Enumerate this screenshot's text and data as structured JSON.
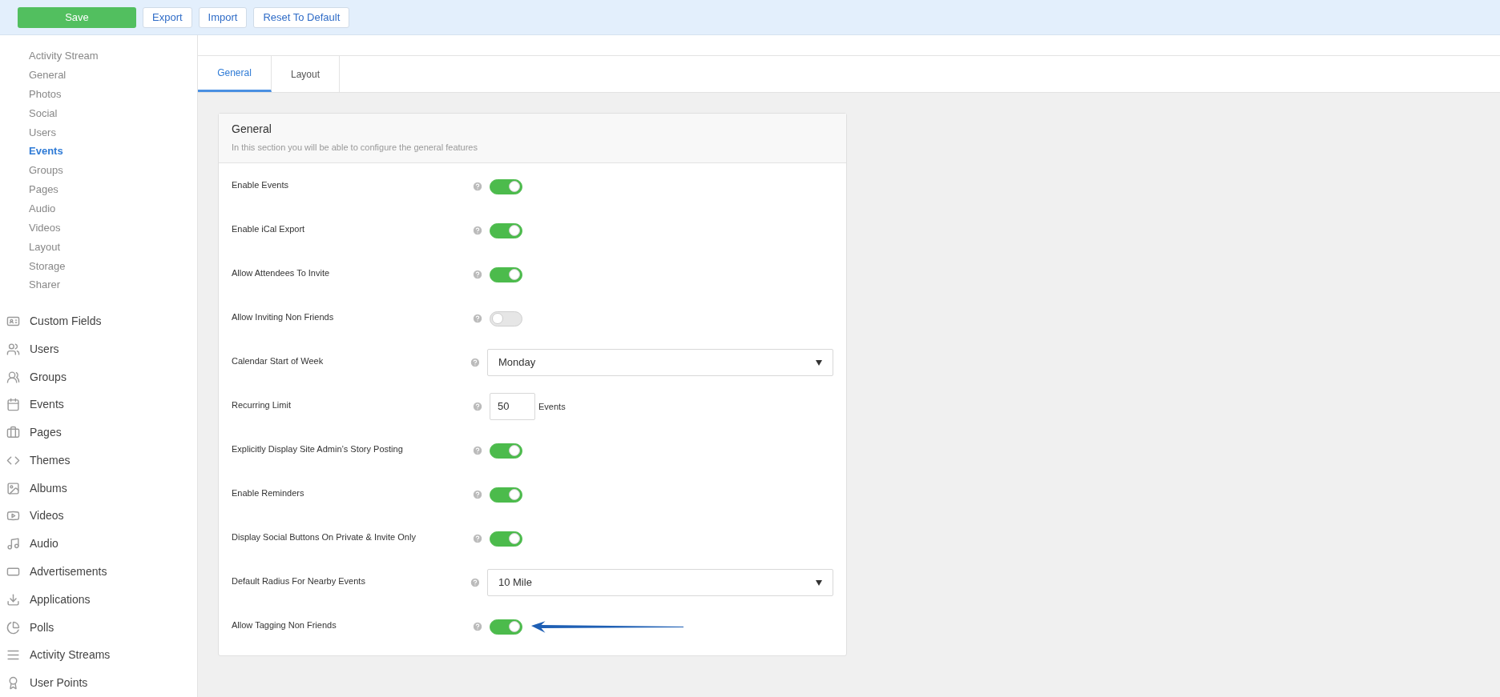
{
  "toolbar": {
    "buttons": [
      {
        "label": "Save",
        "kind": "primary"
      },
      {
        "label": "Export",
        "kind": "secondary"
      },
      {
        "label": "Import",
        "kind": "secondary"
      },
      {
        "label": "Reset To Default",
        "kind": "secondary"
      }
    ]
  },
  "sidebar": {
    "sub_items": [
      {
        "label": "Activity Stream",
        "selected": false
      },
      {
        "label": "General",
        "selected": false
      },
      {
        "label": "Photos",
        "selected": false
      },
      {
        "label": "Social",
        "selected": false
      },
      {
        "label": "Users",
        "selected": false
      },
      {
        "label": "Events",
        "selected": true
      },
      {
        "label": "Groups",
        "selected": false
      },
      {
        "label": "Pages",
        "selected": false
      },
      {
        "label": "Audio",
        "selected": false
      },
      {
        "label": "Videos",
        "selected": false
      },
      {
        "label": "Layout",
        "selected": false
      },
      {
        "label": "Storage",
        "selected": false
      },
      {
        "label": "Sharer",
        "selected": false
      }
    ],
    "menu": [
      {
        "label": "Custom Fields"
      },
      {
        "label": "Users"
      },
      {
        "label": "Groups"
      },
      {
        "label": "Events"
      },
      {
        "label": "Pages"
      },
      {
        "label": "Themes"
      },
      {
        "label": "Albums"
      },
      {
        "label": "Videos"
      },
      {
        "label": "Audio"
      },
      {
        "label": "Advertisements"
      },
      {
        "label": "Applications"
      },
      {
        "label": "Polls"
      },
      {
        "label": "Activity Streams"
      },
      {
        "label": "User Points"
      }
    ]
  },
  "tabs": [
    {
      "label": "General",
      "selected": true
    },
    {
      "label": "Layout",
      "selected": false
    }
  ],
  "panel": {
    "title": "General",
    "description": "In this section you will be able to configure the general features",
    "rows": [
      {
        "kind": "toggle",
        "label": "Enable Events",
        "on": true
      },
      {
        "kind": "toggle",
        "label": "Enable iCal Export",
        "on": true
      },
      {
        "kind": "toggle",
        "label": "Allow Attendees To Invite",
        "on": true
      },
      {
        "kind": "toggle",
        "label": "Allow Inviting Non Friends",
        "on": false
      },
      {
        "kind": "select",
        "label": "Calendar Start of Week",
        "value": "Monday"
      },
      {
        "kind": "number",
        "label": "Recurring Limit",
        "value": "50",
        "unit": "Events"
      },
      {
        "kind": "toggle",
        "label": "Explicitly Display Site Admin’s Story Posting",
        "on": true
      },
      {
        "kind": "toggle",
        "label": "Enable Reminders",
        "on": true
      },
      {
        "kind": "toggle",
        "label": "Display Social Buttons On Private & Invite Only",
        "on": true
      },
      {
        "kind": "select",
        "label": "Default Radius For Nearby Events",
        "value": "10 Mile"
      },
      {
        "kind": "toggle",
        "label": "Allow Tagging Non Friends",
        "on": true,
        "annotated": true
      }
    ]
  }
}
